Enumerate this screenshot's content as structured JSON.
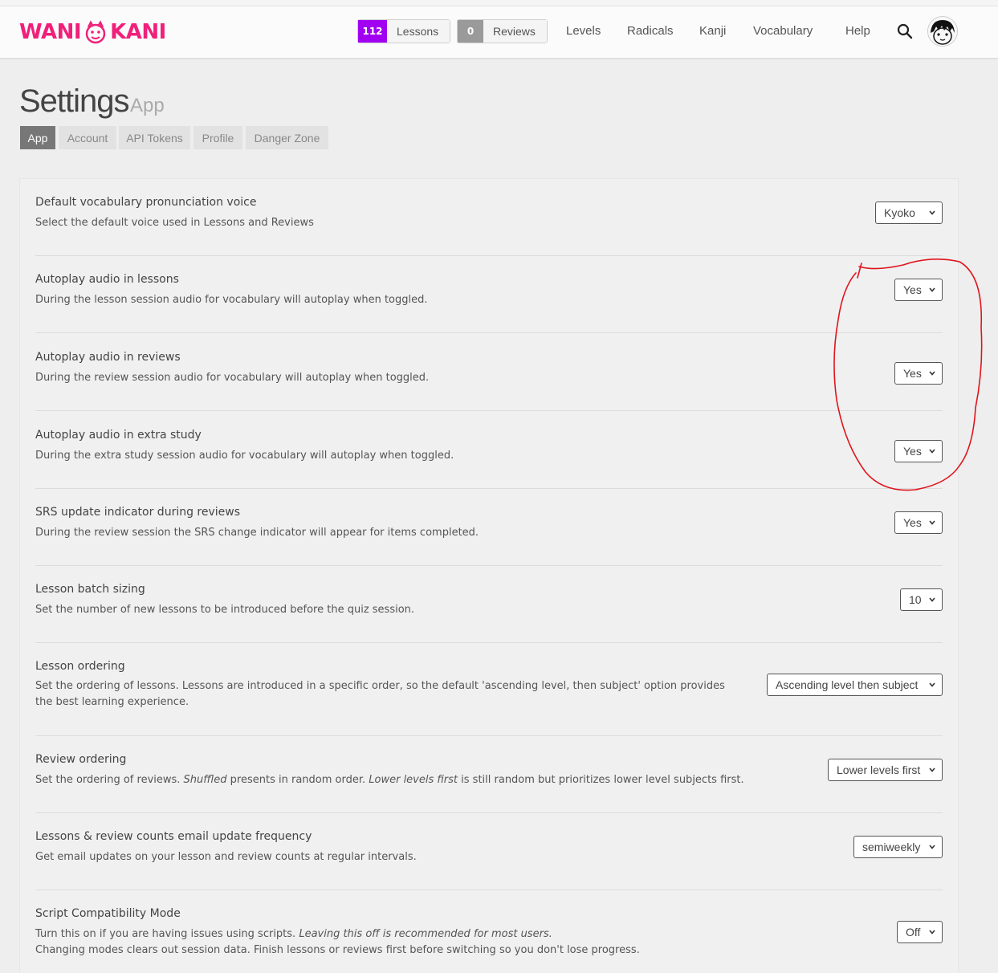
{
  "header": {
    "logo_left": "WANI",
    "logo_right": "KANI",
    "lessons_count": "112",
    "lessons_label": "Lessons",
    "reviews_count": "0",
    "reviews_label": "Reviews",
    "nav": [
      "Levels",
      "Radicals",
      "Kanji",
      "Vocabulary",
      "Help"
    ],
    "lessons_color": "#a100f1",
    "reviews_color": "#9a9a9a"
  },
  "page": {
    "title": "Settings",
    "subtitle": "App",
    "tabs": [
      "App",
      "Account",
      "API Tokens",
      "Profile",
      "Danger Zone"
    ],
    "active_tab": "App"
  },
  "settings": [
    {
      "title": "Default vocabulary pronunciation voice",
      "desc": "Select the default voice used in Lessons and Reviews",
      "value": "Kyoko"
    },
    {
      "title": "Autoplay audio in lessons",
      "desc": "During the lesson session audio for vocabulary will autoplay when toggled.",
      "value": "Yes"
    },
    {
      "title": "Autoplay audio in reviews",
      "desc": "During the review session audio for vocabulary will autoplay when toggled.",
      "value": "Yes"
    },
    {
      "title": "Autoplay audio in extra study",
      "desc": "During the extra study session audio for vocabulary will autoplay when toggled.",
      "value": "Yes"
    },
    {
      "title": "SRS update indicator during reviews",
      "desc": "During the review session the SRS change indicator will appear for items completed.",
      "value": "Yes"
    },
    {
      "title": "Lesson batch sizing",
      "desc": "Set the number of new lessons to be introduced before the quiz session.",
      "value": "10"
    },
    {
      "title": "Lesson ordering",
      "desc": "Set the ordering of lessons. Lessons are introduced in a specific order, so the default 'ascending level, then subject' option provides the best learning experience.",
      "value": "Ascending level then subject"
    },
    {
      "title": "Review ordering",
      "desc_parts": [
        "Set the ordering of reviews. ",
        "Shuffled",
        " presents in random order. ",
        "Lower levels first",
        " is still random but prioritizes lower level subjects first."
      ],
      "value": "Lower levels first"
    },
    {
      "title": "Lessons & review counts email update frequency",
      "desc": "Get email updates on your lesson and review counts at regular intervals.",
      "value": "semiweekly"
    },
    {
      "title": "Script Compatibility Mode",
      "desc_parts": [
        "Turn this on if you are having issues using scripts. ",
        "Leaving this off is recommended for most users.",
        "Changing modes clears out session data. Finish lessons or reviews first before switching so you don't lose progress."
      ],
      "value": "Off"
    }
  ],
  "annotation_color": "#e0141c"
}
